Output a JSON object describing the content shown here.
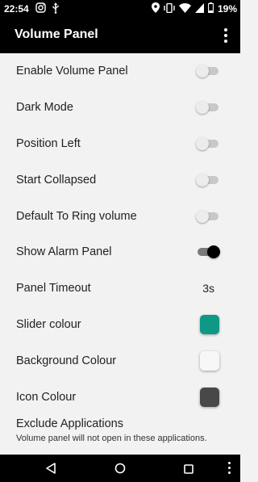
{
  "status_bar": {
    "time": "22:54",
    "left_icons": [
      "instagram-icon",
      "usb-icon"
    ],
    "right_icons": [
      "location-icon",
      "vibrate-icon",
      "wifi-icon",
      "signal-icon",
      "battery-icon"
    ],
    "battery_percent": "19%"
  },
  "app_bar": {
    "title": "Volume Panel",
    "menu_icon": "overflow-menu-icon"
  },
  "settings": {
    "enable_volume_panel": {
      "label": "Enable Volume Panel",
      "enabled": false
    },
    "dark_mode": {
      "label": "Dark Mode",
      "enabled": false
    },
    "position_left": {
      "label": "Position Left",
      "enabled": false
    },
    "start_collapsed": {
      "label": "Start Collapsed",
      "enabled": false
    },
    "default_to_ring_volume": {
      "label": "Default To Ring volume",
      "enabled": false
    },
    "show_alarm_panel": {
      "label": "Show Alarm Panel",
      "enabled": true
    },
    "panel_timeout": {
      "label": "Panel Timeout",
      "value": "3s"
    },
    "slider_colour": {
      "label": "Slider colour",
      "color": "#0f9886"
    },
    "background_colour": {
      "label": "Background Colour",
      "color": "#f7f7f7"
    },
    "icon_colour": {
      "label": "Icon Colour",
      "color": "#484848"
    },
    "exclude_applications": {
      "label": "Exclude Applications",
      "description": "Volume panel will not open in these applications."
    }
  },
  "nav_bar": {
    "icons": [
      "back-icon",
      "home-icon",
      "recents-icon",
      "nav-menu-icon"
    ]
  },
  "colors": {
    "app_bar": "#000000",
    "background": "#f2f2f2",
    "switch_on_thumb": "#000000",
    "switch_off_track": "#c8c8c8"
  }
}
